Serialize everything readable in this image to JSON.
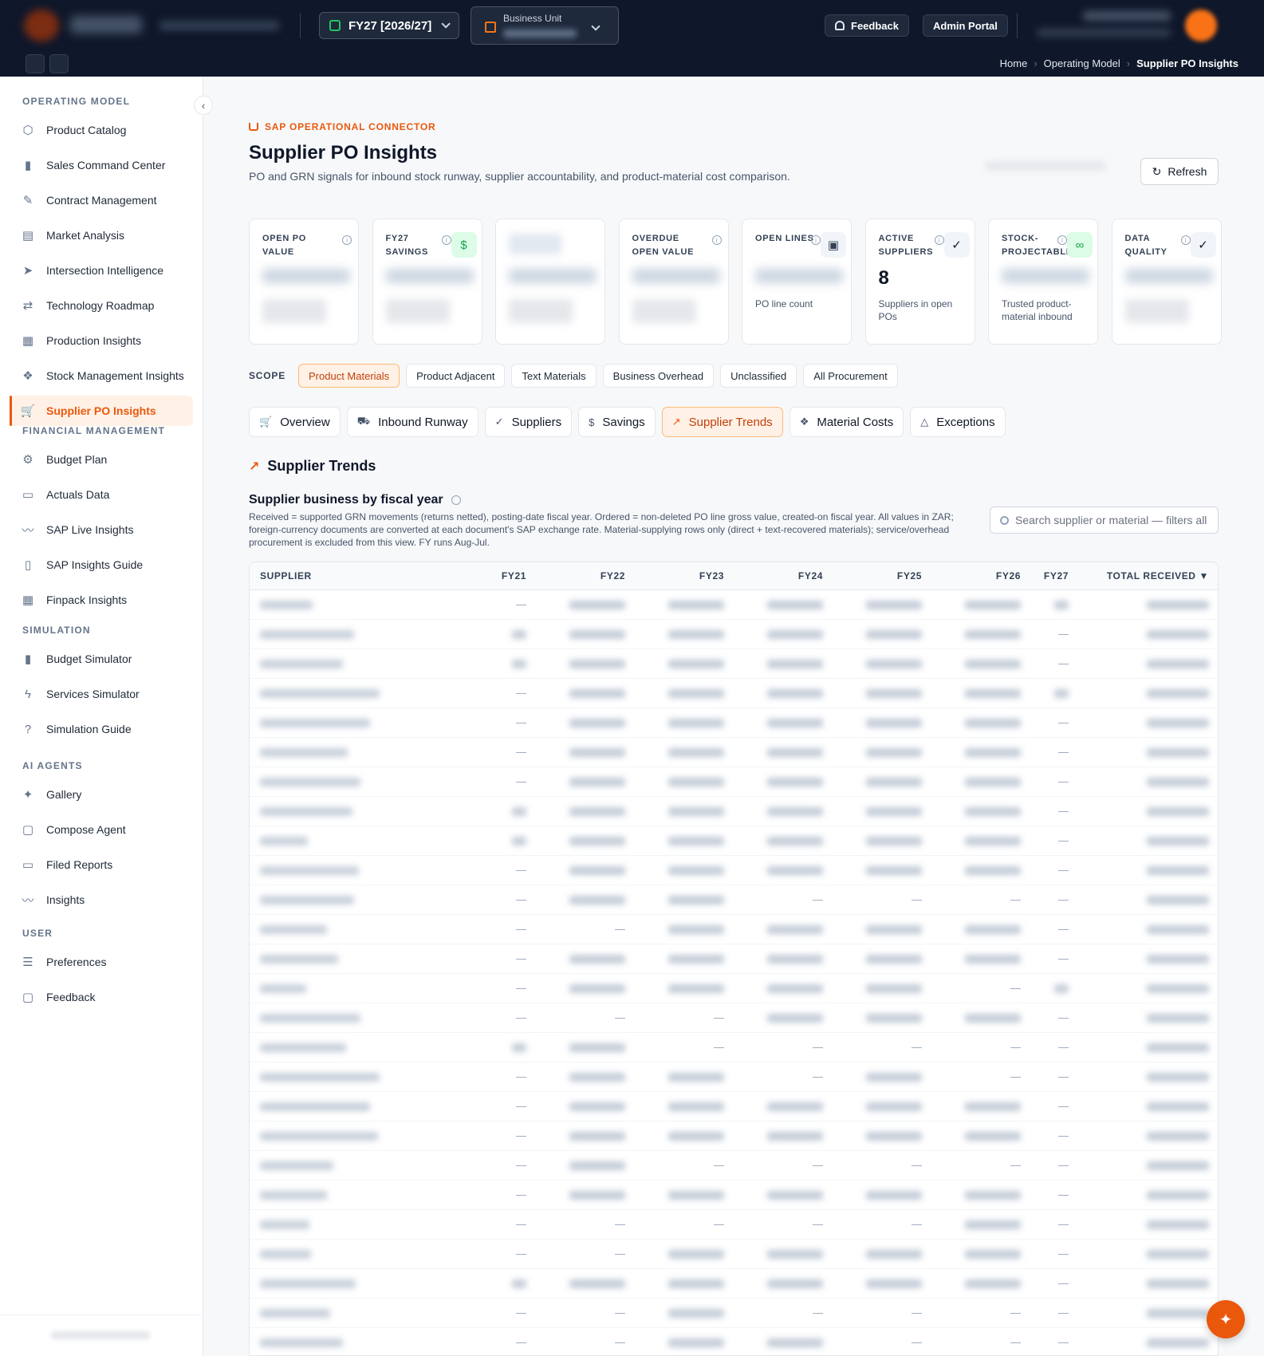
{
  "header": {
    "fiscal_year": "FY27 [2026/27]",
    "business_unit_label": "Business Unit",
    "feedback_label": "Feedback",
    "admin_label": "Admin Portal"
  },
  "breadcrumb": [
    "Home",
    "Operating Model",
    "Supplier PO Insights"
  ],
  "sidebar": {
    "sections": [
      {
        "title": "OPERATING MODEL",
        "items": [
          {
            "label": "Product Catalog",
            "icon": "box-icon"
          },
          {
            "label": "Sales Command Center",
            "icon": "bar-chart-icon"
          },
          {
            "label": "Contract Management",
            "icon": "edit-icon"
          },
          {
            "label": "Market Analysis",
            "icon": "map-icon"
          },
          {
            "label": "Intersection Intelligence",
            "icon": "send-icon"
          },
          {
            "label": "Technology Roadmap",
            "icon": "route-icon"
          },
          {
            "label": "Production Insights",
            "icon": "factory-icon"
          },
          {
            "label": "Stock Management Insights",
            "icon": "boxes-icon"
          },
          {
            "label": "Supplier PO Insights",
            "icon": "cart-icon",
            "active": true
          }
        ]
      },
      {
        "title": "FINANCIAL MANAGEMENT",
        "items": [
          {
            "label": "Budget Plan",
            "icon": "gear-icon"
          },
          {
            "label": "Actuals Data",
            "icon": "document-icon"
          },
          {
            "label": "SAP Live Insights",
            "icon": "activity-icon"
          },
          {
            "label": "SAP Insights Guide",
            "icon": "book-icon"
          },
          {
            "label": "Finpack Insights",
            "icon": "spreadsheet-icon"
          }
        ]
      },
      {
        "title": "SIMULATION",
        "items": [
          {
            "label": "Budget Simulator",
            "icon": "bar-chart-icon"
          },
          {
            "label": "Services Simulator",
            "icon": "lightning-icon"
          },
          {
            "label": "Simulation Guide",
            "icon": "help-circle-icon"
          }
        ]
      },
      {
        "title": "AI AGENTS",
        "items": [
          {
            "label": "Gallery",
            "icon": "sparkles-icon"
          },
          {
            "label": "Compose Agent",
            "icon": "message-icon"
          },
          {
            "label": "Filed Reports",
            "icon": "document-icon"
          },
          {
            "label": "Insights",
            "icon": "activity-icon"
          }
        ]
      },
      {
        "title": "USER",
        "items": [
          {
            "label": "Preferences",
            "icon": "sliders-icon"
          },
          {
            "label": "Feedback",
            "icon": "message-icon"
          }
        ]
      }
    ]
  },
  "page": {
    "eyebrow": "SAP OPERATIONAL CONNECTOR",
    "title": "Supplier PO Insights",
    "subtitle": "PO and GRN signals for inbound stock runway, supplier accountability, and product-material cost comparison.",
    "refresh_label": "Refresh"
  },
  "kpis": [
    {
      "label": "OPEN PO VALUE",
      "value": "",
      "desc": "",
      "badge": null
    },
    {
      "label": "FY27 SAVINGS",
      "value": "",
      "desc": "",
      "badge": "dollar-icon"
    },
    {
      "label": "",
      "value": "",
      "desc": "",
      "badge": null
    },
    {
      "label": "OVERDUE OPEN VALUE",
      "value": "",
      "desc": "",
      "badge": null
    },
    {
      "label": "OPEN LINES",
      "value": "",
      "desc": "PO line count",
      "badge": "clipboard-icon"
    },
    {
      "label": "ACTIVE SUPPLIERS",
      "value": "8",
      "desc": "Suppliers in open POs",
      "badge": "check-circle-icon"
    },
    {
      "label": "STOCK-PROJECTABLE",
      "value": "",
      "desc": "Trusted product-material inbound",
      "badge": "link-icon"
    },
    {
      "label": "DATA QUALITY",
      "value": "",
      "desc": "",
      "badge": "check-circle-icon"
    }
  ],
  "scope": {
    "label": "SCOPE",
    "chips": [
      "Product Materials",
      "Product Adjacent",
      "Text Materials",
      "Business Overhead",
      "Unclassified",
      "All Procurement"
    ],
    "active": 0
  },
  "tabs": [
    {
      "label": "Overview",
      "icon": "cart-icon"
    },
    {
      "label": "Inbound Runway",
      "icon": "truck-icon"
    },
    {
      "label": "Suppliers",
      "icon": "check-circle-icon"
    },
    {
      "label": "Savings",
      "icon": "dollar-icon"
    },
    {
      "label": "Supplier Trends",
      "icon": "trend-up-icon",
      "active": true
    },
    {
      "label": "Material Costs",
      "icon": "boxes-icon"
    },
    {
      "label": "Exceptions",
      "icon": "warning-icon"
    }
  ],
  "section_title": "Supplier Trends",
  "card": {
    "title": "Supplier business by fiscal year",
    "description": "Received = supported GRN movements (returns netted), posting-date fiscal year. Ordered = non-deleted PO line gross value, created-on fiscal year. All values in ZAR; foreign-currency documents are converted at each document's SAP exchange rate. Material-supplying rows only (direct + text-recovered materials); service/overhead procurement is excluded from this view. FY runs Aug-Jul.",
    "search_placeholder": "Search supplier or material — filters all"
  },
  "table": {
    "columns": [
      "SUPPLIER",
      "FY21",
      "FY22",
      "FY23",
      "FY24",
      "FY25",
      "FY26",
      "FY27",
      "TOTAL RECEIVED ▼"
    ],
    "dash": "—",
    "rows": [
      [
        1,
        0,
        1,
        1,
        1,
        1,
        1,
        1,
        1
      ],
      [
        1,
        1,
        1,
        1,
        1,
        1,
        1,
        0,
        1
      ],
      [
        1,
        1,
        1,
        1,
        1,
        1,
        1,
        0,
        1
      ],
      [
        1,
        0,
        1,
        1,
        1,
        1,
        1,
        1,
        1
      ],
      [
        1,
        0,
        1,
        1,
        1,
        1,
        1,
        0,
        1
      ],
      [
        1,
        0,
        1,
        1,
        1,
        1,
        1,
        0,
        1
      ],
      [
        1,
        0,
        1,
        1,
        1,
        1,
        1,
        0,
        1
      ],
      [
        1,
        1,
        1,
        1,
        1,
        1,
        1,
        0,
        1
      ],
      [
        1,
        1,
        1,
        1,
        1,
        1,
        1,
        0,
        1
      ],
      [
        1,
        0,
        1,
        1,
        1,
        1,
        1,
        0,
        1
      ],
      [
        1,
        0,
        1,
        1,
        0,
        0,
        0,
        0,
        1
      ],
      [
        1,
        0,
        0,
        1,
        1,
        1,
        1,
        0,
        1
      ],
      [
        1,
        0,
        1,
        1,
        1,
        1,
        1,
        0,
        1
      ],
      [
        1,
        0,
        1,
        1,
        1,
        1,
        0,
        1,
        1
      ],
      [
        1,
        0,
        0,
        0,
        1,
        1,
        1,
        0,
        1
      ],
      [
        1,
        1,
        1,
        0,
        0,
        0,
        0,
        0,
        1
      ],
      [
        1,
        0,
        1,
        1,
        0,
        1,
        0,
        0,
        1
      ],
      [
        1,
        0,
        1,
        1,
        1,
        1,
        1,
        0,
        1
      ],
      [
        1,
        0,
        1,
        1,
        1,
        1,
        1,
        0,
        1
      ],
      [
        1,
        0,
        1,
        0,
        0,
        0,
        0,
        0,
        1
      ],
      [
        1,
        0,
        1,
        1,
        1,
        1,
        1,
        0,
        1
      ],
      [
        1,
        0,
        0,
        0,
        0,
        0,
        1,
        0,
        1
      ],
      [
        1,
        0,
        0,
        1,
        1,
        1,
        1,
        0,
        1
      ],
      [
        1,
        1,
        1,
        1,
        1,
        1,
        1,
        0,
        1
      ],
      [
        1,
        0,
        0,
        1,
        0,
        0,
        0,
        0,
        1
      ],
      [
        1,
        0,
        0,
        1,
        1,
        0,
        0,
        0,
        1
      ]
    ]
  }
}
